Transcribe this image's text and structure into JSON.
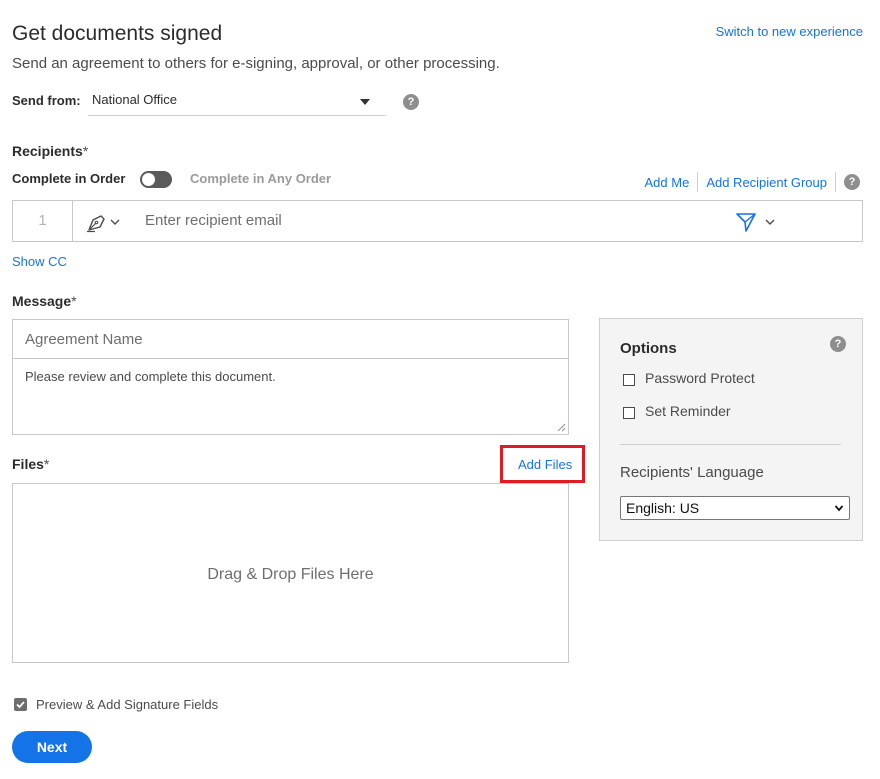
{
  "header": {
    "title": "Get documents signed",
    "subtitle": "Send an agreement to others for e-signing, approval, or other processing.",
    "switch_link": "Switch to new experience"
  },
  "send_from": {
    "label": "Send from:",
    "value": "National Office",
    "help_icon": "?"
  },
  "recipients": {
    "label": "Recipients",
    "required_mark": "*",
    "complete_in_order": "Complete in Order",
    "complete_any_order": "Complete in Any Order",
    "add_me": "Add Me",
    "add_group": "Add Recipient Group",
    "help_icon": "?",
    "row": {
      "number": "1",
      "role_icon": "pen-signer-icon",
      "email_placeholder": "Enter recipient email",
      "auth_icon": "send-arrow-icon"
    },
    "show_cc": "Show CC"
  },
  "message": {
    "label": "Message",
    "required_mark": "*",
    "agreement_placeholder": "Agreement Name",
    "body": "Please review and complete this document."
  },
  "files": {
    "label": "Files",
    "required_mark": "*",
    "add_files": "Add Files",
    "drop_text": "Drag & Drop Files Here"
  },
  "options": {
    "title": "Options",
    "help_icon": "?",
    "password_protect": "Password Protect",
    "set_reminder": "Set Reminder",
    "language_label": "Recipients' Language",
    "language_value": "English: US"
  },
  "footer": {
    "preview_label": "Preview & Add Signature Fields",
    "next_button": "Next"
  },
  "colors": {
    "accent": "#1473e6",
    "highlight_box": "#e01b24",
    "options_bg": "#f4f4f4"
  }
}
